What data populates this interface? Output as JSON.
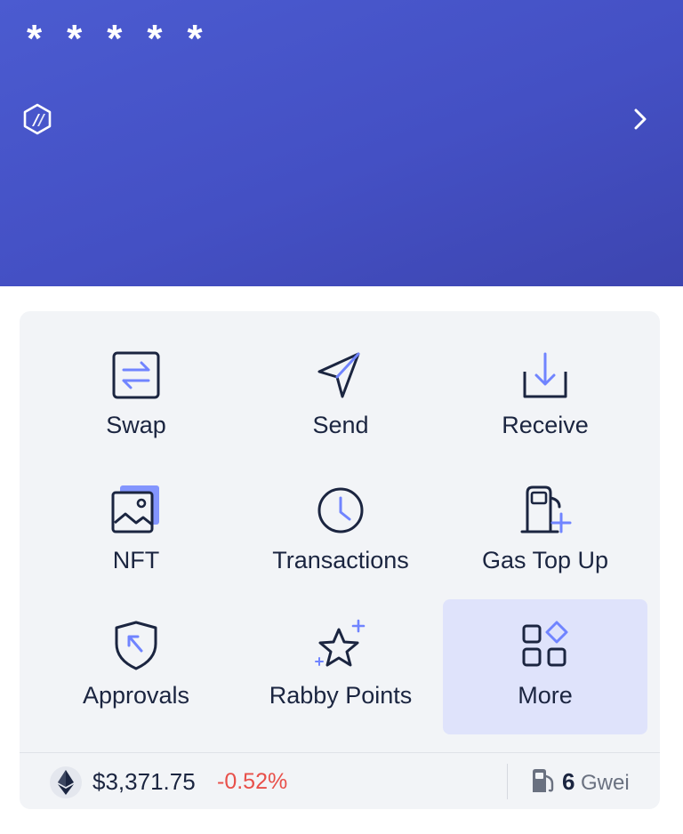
{
  "header": {
    "balance_masked": "*****",
    "chain_icon": "arbitrum-logo-icon",
    "chevron_icon": "chevron-right-icon",
    "background_colors": [
      "#4b5bd0",
      "#3d45b0"
    ]
  },
  "actions": [
    {
      "label": "Swap",
      "icon": "swap-icon",
      "active": false
    },
    {
      "label": "Send",
      "icon": "send-icon",
      "active": false
    },
    {
      "label": "Receive",
      "icon": "receive-icon",
      "active": false
    },
    {
      "label": "NFT",
      "icon": "nft-icon",
      "active": false
    },
    {
      "label": "Transactions",
      "icon": "clock-icon",
      "active": false
    },
    {
      "label": "Gas Top Up",
      "icon": "gas-pump-icon",
      "active": false
    },
    {
      "label": "Approvals",
      "icon": "shield-icon",
      "active": false
    },
    {
      "label": "Rabby Points",
      "icon": "star-icon",
      "active": false
    },
    {
      "label": "More",
      "icon": "grid-more-icon",
      "active": true
    }
  ],
  "footer": {
    "token_icon": "ethereum-icon",
    "price": "$3,371.75",
    "change": "-0.52%",
    "gas_icon": "gas-pump-icon",
    "gas_value": "6",
    "gas_unit": "Gwei"
  },
  "colors": {
    "accent": "#7084ff",
    "icon_dark": "#1b2540",
    "active_tile": "#dfe3fb",
    "negative": "#e8504a"
  }
}
